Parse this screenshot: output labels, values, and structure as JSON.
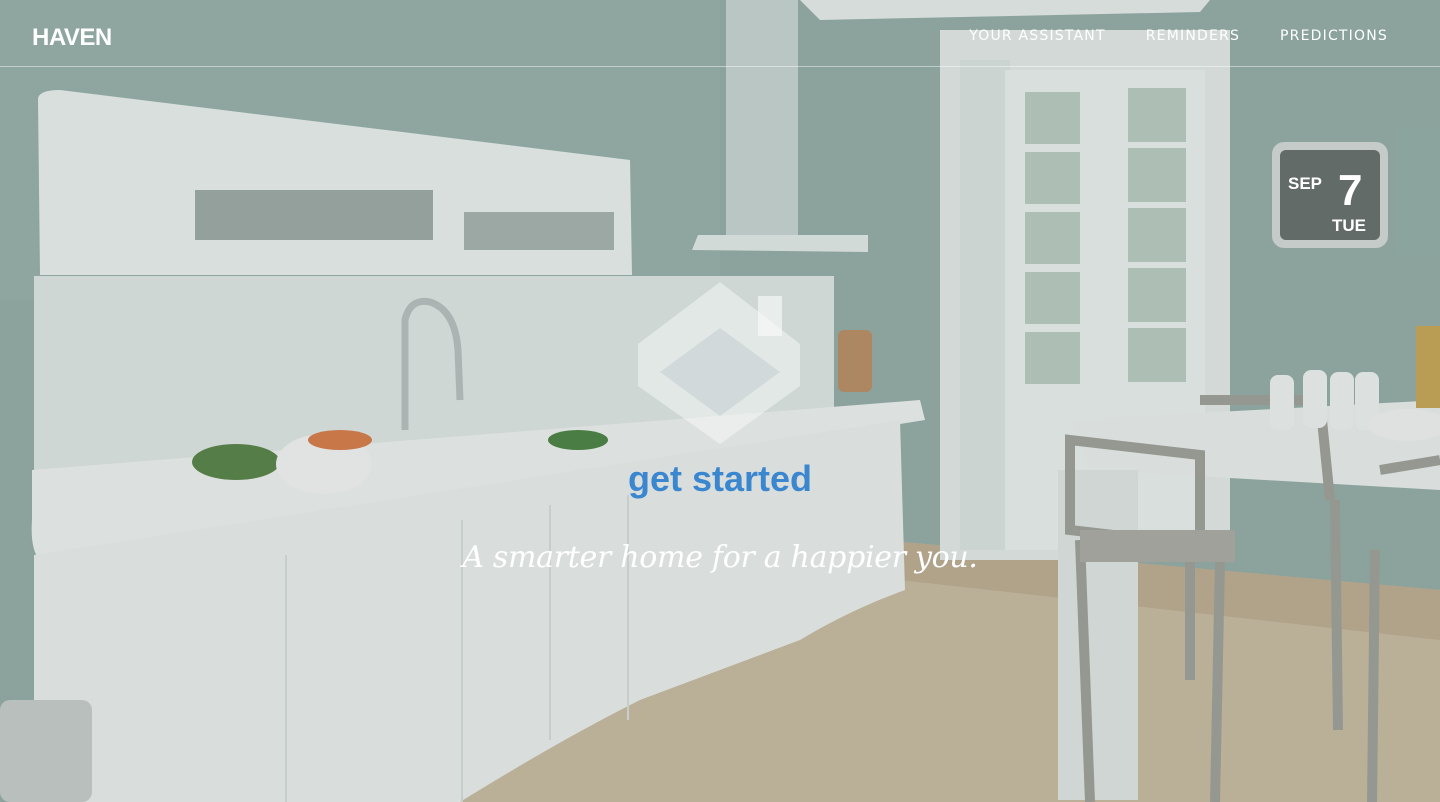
{
  "header": {
    "brand": "HAVEN",
    "nav": [
      {
        "label": "YOUR ASSISTANT"
      },
      {
        "label": "REMINDERS"
      },
      {
        "label": "PREDICTIONS"
      }
    ]
  },
  "hero": {
    "logo_icon": "house-logo-icon",
    "cta_label": "get started",
    "tagline": "A smarter home for a happier you."
  },
  "wall_clock": {
    "month": "SEP",
    "day": "7",
    "weekday": "TUE"
  },
  "colors": {
    "cta": "#3a86cf",
    "nav_text": "#ffffff",
    "wall": "#8fa7a0"
  }
}
